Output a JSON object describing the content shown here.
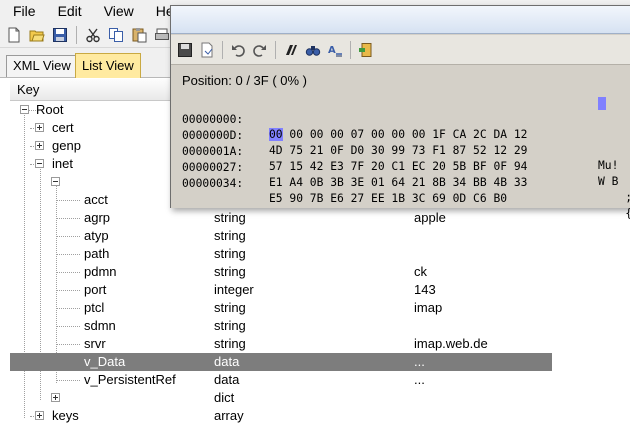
{
  "menubar": {
    "items": [
      "File",
      "Edit",
      "View",
      "He"
    ]
  },
  "tabs": [
    {
      "label": "XML View",
      "active": false
    },
    {
      "label": "List View",
      "active": true
    }
  ],
  "columns": {
    "key": "Key"
  },
  "tree": [
    {
      "key": "Root",
      "type": "",
      "value": ""
    },
    {
      "key": "cert",
      "type": "",
      "value": ""
    },
    {
      "key": "genp",
      "type": "",
      "value": ""
    },
    {
      "key": "inet",
      "type": "",
      "value": ""
    },
    {
      "key": "",
      "type": "",
      "value": ""
    },
    {
      "key": "acct",
      "type": "",
      "value": ""
    },
    {
      "key": "agrp",
      "type": "string",
      "value": "apple"
    },
    {
      "key": "atyp",
      "type": "string",
      "value": ""
    },
    {
      "key": "path",
      "type": "string",
      "value": ""
    },
    {
      "key": "pdmn",
      "type": "string",
      "value": "ck"
    },
    {
      "key": "port",
      "type": "integer",
      "value": "143"
    },
    {
      "key": "ptcl",
      "type": "string",
      "value": "imap"
    },
    {
      "key": "sdmn",
      "type": "string",
      "value": ""
    },
    {
      "key": "srvr",
      "type": "string",
      "value": "imap.web.de"
    },
    {
      "key": "v_Data",
      "type": "data",
      "value": "..."
    },
    {
      "key": "v_PersistentRef",
      "type": "data",
      "value": "..."
    },
    {
      "key": "",
      "type": "dict",
      "value": ""
    },
    {
      "key": "keys",
      "type": "array",
      "value": ""
    }
  ],
  "hex": {
    "position": "Position: 0 / 3F ( 0% )",
    "rows": [
      {
        "offset": "00000000:",
        "cursor": "00",
        "bytes": " 00 00 00 07 00 00 00 1F CA 2C DA 12",
        "ascii": ""
      },
      {
        "offset": "0000000D:",
        "cursor": "",
        "bytes": "4D 75 21 0F D0 30 99 73 F1 87 52 12 29",
        "ascii": "Mu!"
      },
      {
        "offset": "0000001A:",
        "cursor": "",
        "bytes": "57 15 42 E3 7F 20 C1 EC 20 5B BF 0F 94",
        "ascii": "W B"
      },
      {
        "offset": "00000027:",
        "cursor": "",
        "bytes": "E1 A4 0B 3B 3E 01 64 21 8B 34 BB 4B 33",
        "ascii": "    ;"
      },
      {
        "offset": "00000034:",
        "cursor": "",
        "bytes": "E5 90 7B E6 27 EE 1B 3C 69 0D C6 B0",
        "ascii": "    {"
      }
    ]
  },
  "colors": {
    "selected_row": "#7d7d7d",
    "active_tab": "#ffeaa0",
    "hex_cursor": "#8080ff"
  }
}
